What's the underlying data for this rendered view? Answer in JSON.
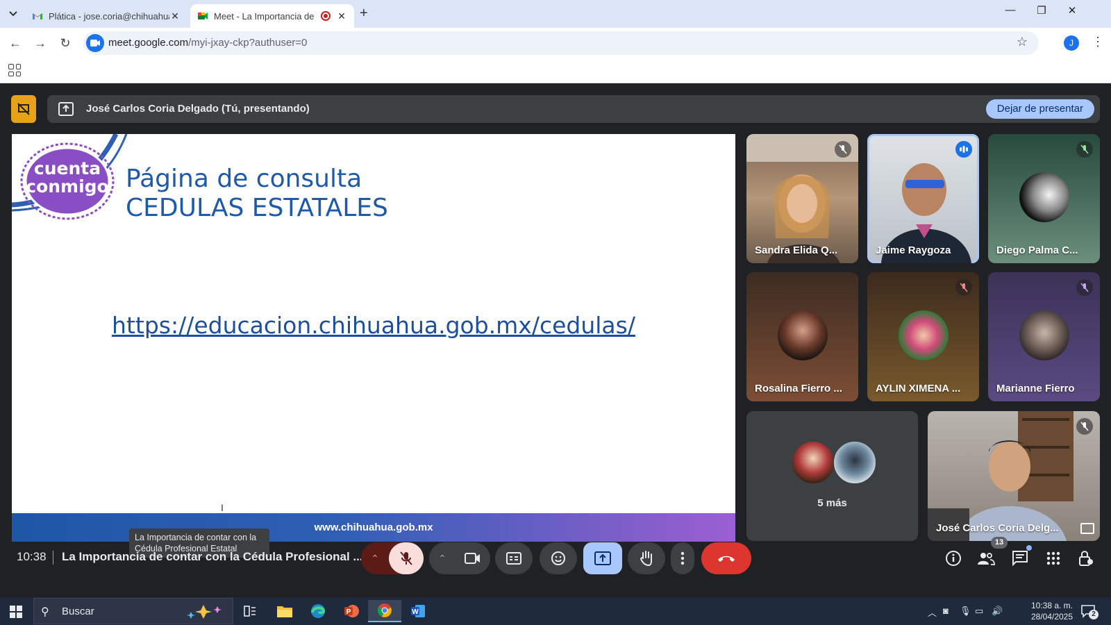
{
  "browser": {
    "tabs": [
      {
        "title": "Plática - jose.coria@chihuahua.gob.mx",
        "active": false
      },
      {
        "title": "Meet - La Importancia de contar",
        "active": true
      }
    ],
    "url_host": "meet.google.com",
    "url_path": "/myi-jxay-ckp?authuser=0",
    "profile_initial": "J"
  },
  "meet": {
    "presenter_banner": "José Carlos Coria Delgado (Tú, presentando)",
    "stop_presenting": "Dejar de presentar",
    "slide": {
      "logo_line1": "cuenta",
      "logo_line2": "conmigo",
      "title_line1": "Página de consulta",
      "title_line2": "CEDULAS ESTATALES",
      "link": "https://educacion.chihuahua.gob.mx/cedulas/",
      "footer": "www.chihuahua.gob.mx"
    },
    "tooltip": "La Importancia de contar con la Cédula Profesional Estatal",
    "participants": [
      {
        "name": "Sandra Elida Q..."
      },
      {
        "name": "Jaime Raygoza"
      },
      {
        "name": "Diego Palma C..."
      },
      {
        "name": "Rosalina Fierro ..."
      },
      {
        "name": "AYLIN XIMENA ..."
      },
      {
        "name": "Marianne Fierro"
      },
      {
        "name": "José Carlos Coria Delg..."
      }
    ],
    "more_participants": "5 más",
    "time": "10:38",
    "meeting_title": "La Importancia de contar con la Cédula Profesional ...",
    "participant_count": "13"
  },
  "taskbar": {
    "search_label": "Buscar",
    "clock_time": "10:38 a. m.",
    "clock_date": "28/04/2025",
    "notification_count": "2"
  }
}
